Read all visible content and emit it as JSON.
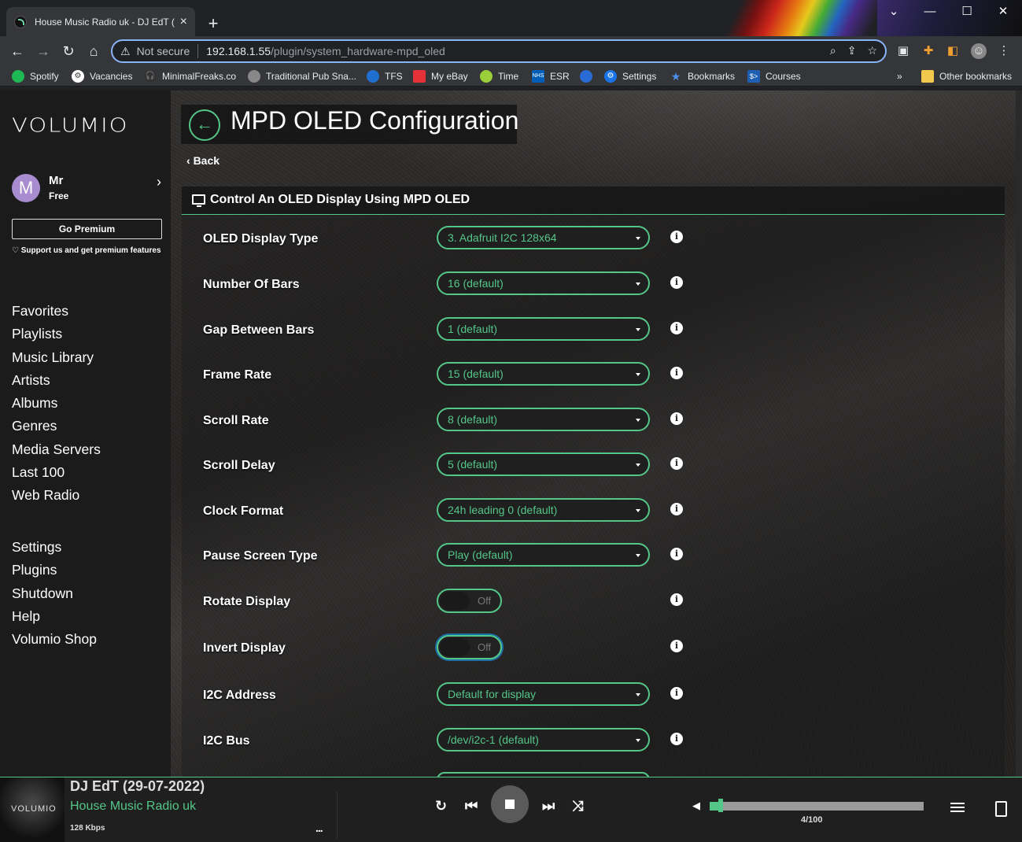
{
  "browser": {
    "tab_title": "House Music Radio uk - DJ EdT (",
    "url_warning": "Not secure",
    "url_host": "192.168.1.55",
    "url_path": "/plugin/system_hardware-mpd_oled",
    "bookmarks": [
      "Spotify",
      "Vacancies",
      "MinimalFreaks.co",
      "Traditional Pub Sna...",
      "TFS",
      "My eBay",
      "Time",
      "ESR",
      "",
      "Settings",
      "Bookmarks",
      "Courses"
    ],
    "bookmarks_overflow": "»",
    "other_bookmarks": "Other bookmarks"
  },
  "sidebar": {
    "logo": "VOLUMIO",
    "user": {
      "initial": "M",
      "name": "Mr",
      "plan": "Free"
    },
    "go_premium": "Go Premium",
    "support_text": "Support us and get premium features",
    "menu1": [
      "Favorites",
      "Playlists",
      "Music Library",
      "Artists",
      "Albums",
      "Genres",
      "Media Servers",
      "Last 100",
      "Web Radio"
    ],
    "menu2": [
      "Settings",
      "Plugins",
      "Shutdown",
      "Help",
      "Volumio Shop"
    ]
  },
  "page": {
    "title": "MPD OLED Configuration",
    "back": "Back",
    "section_title": "Control An OLED Display Using MPD OLED",
    "settings": [
      {
        "label": "OLED Display Type",
        "value": "3. Adafruit I2C 128x64",
        "kind": "select"
      },
      {
        "label": "Number Of Bars",
        "value": "16 (default)",
        "kind": "select"
      },
      {
        "label": "Gap Between Bars",
        "value": "1 (default)",
        "kind": "select"
      },
      {
        "label": "Frame Rate",
        "value": "15 (default)",
        "kind": "select"
      },
      {
        "label": "Scroll Rate",
        "value": "8 (default)",
        "kind": "select"
      },
      {
        "label": "Scroll Delay",
        "value": "5 (default)",
        "kind": "select"
      },
      {
        "label": "Clock Format",
        "value": "24h leading 0 (default)",
        "kind": "select"
      },
      {
        "label": "Pause Screen Type",
        "value": "Play (default)",
        "kind": "select"
      },
      {
        "label": "Rotate Display",
        "value": "Off",
        "kind": "toggle"
      },
      {
        "label": "Invert Display",
        "value": "Off",
        "kind": "toggle"
      },
      {
        "label": "I2C Address",
        "value": "Default for display",
        "kind": "select"
      },
      {
        "label": "I2C Bus",
        "value": "/dev/i2c-1 (default)",
        "kind": "select"
      }
    ]
  },
  "player": {
    "art_text": "VOLUMIO",
    "track": "DJ EdT (29-07-2022)",
    "artist": "House Music Radio uk",
    "bitrate": "128 Kbps",
    "more": "...",
    "volume": 4,
    "volume_text": "4/100"
  },
  "colors": {
    "accent": "#54c688",
    "sidebar_bg": "#1b1b1b",
    "player_bg": "#1f1f1f"
  }
}
